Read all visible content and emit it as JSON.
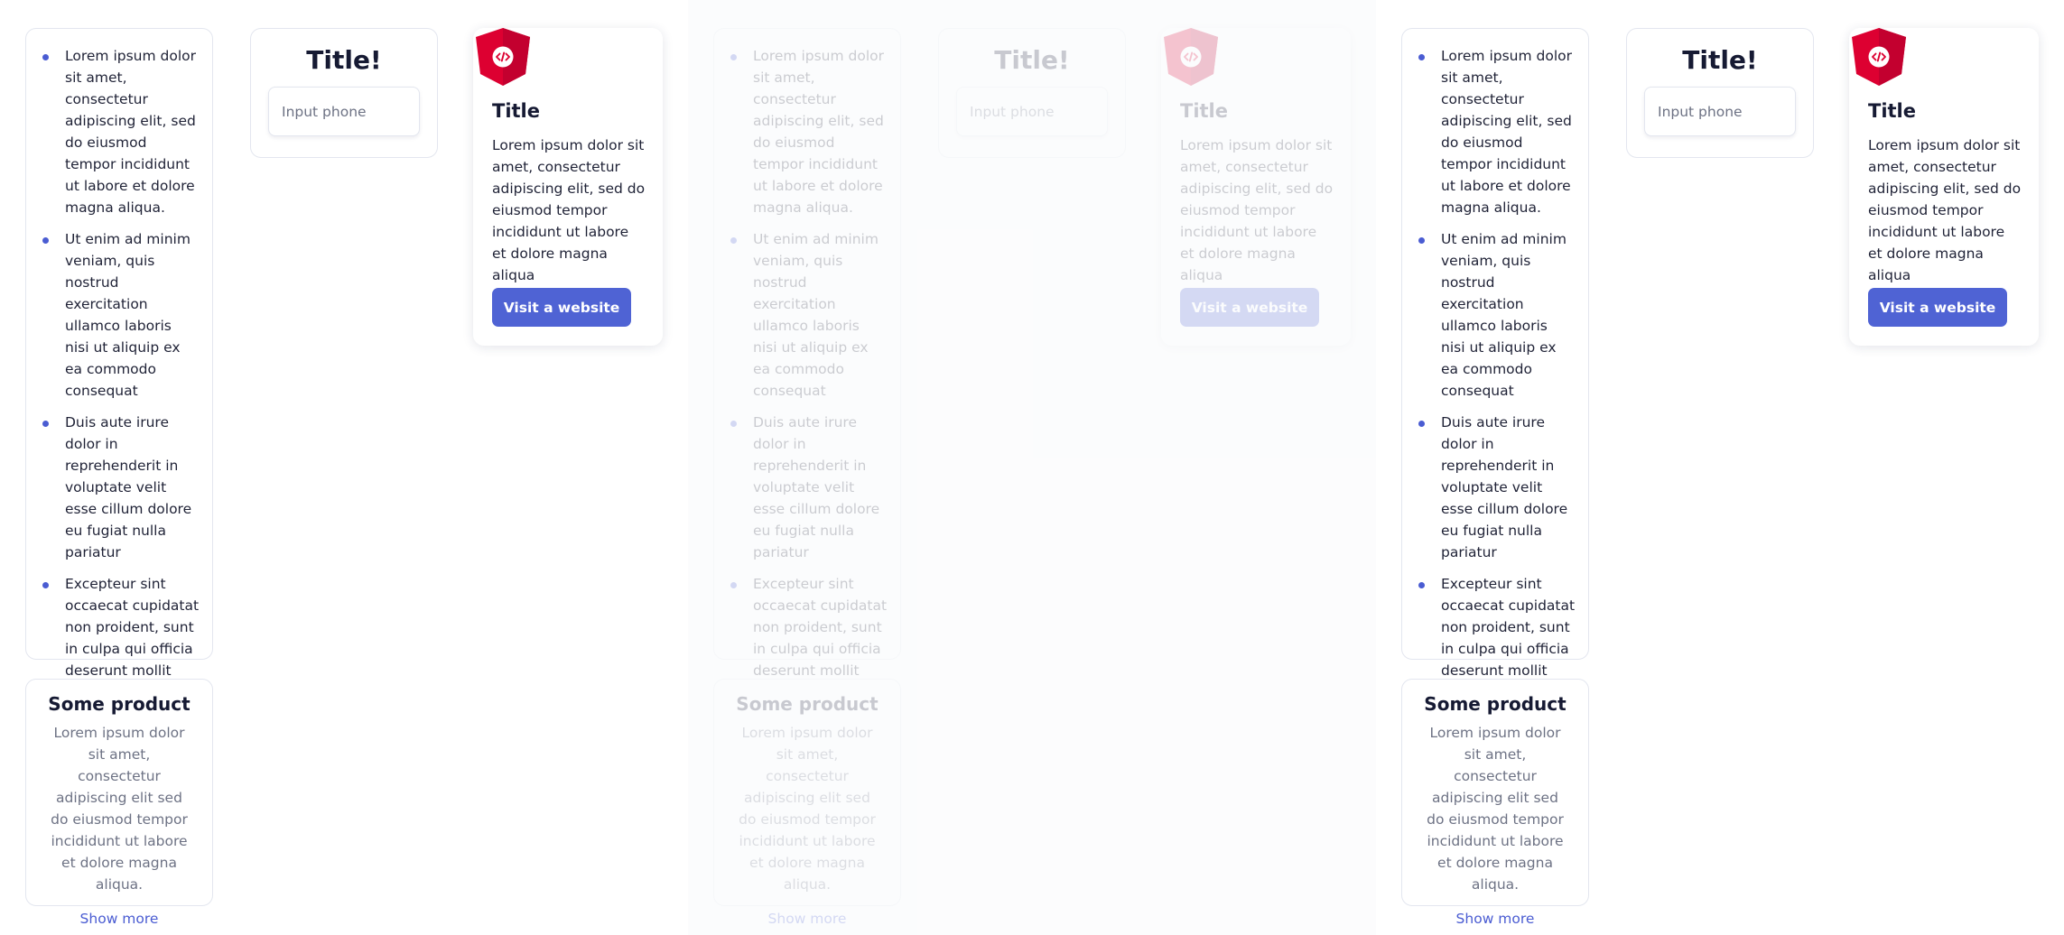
{
  "list_card": {
    "items": [
      "Lorem ipsum dolor sit amet, consectetur adipiscing elit, sed do eiusmod tempor incididunt ut labore et dolore magna aliqua.",
      "Ut enim ad minim veniam, quis nostrud exercitation ullamco laboris nisi ut aliquip ex ea commodo consequat",
      "Duis aute irure dolor in reprehenderit in voluptate velit esse cillum dolore eu fugiat nulla pariatur",
      "Excepteur sint occaecat cupidatat non proident, sunt in culpa qui officia deserunt mollit anim id est laborum"
    ]
  },
  "product_card": {
    "title": "Some product",
    "text": "Lorem ipsum dolor sit amet, consectetur adipiscing elit sed do eiusmod tempor incididunt ut labore et dolore magna aliqua.",
    "link": "Show more"
  },
  "input_card": {
    "title": "Title!",
    "placeholder": "Input phone"
  },
  "feature_card": {
    "badge_icon": "code-icon",
    "title": "Title",
    "text": "Lorem ipsum dolor sit amet, consectetur adipiscing elit, sed do eiusmod tempor incididunt ut labore et dolore magna aliqua",
    "button": "Visit a website"
  },
  "colors": {
    "accent": "#4f63d4",
    "badge": "#dd0031",
    "border": "#e3e6ef",
    "muted_text": "#6d7284"
  }
}
